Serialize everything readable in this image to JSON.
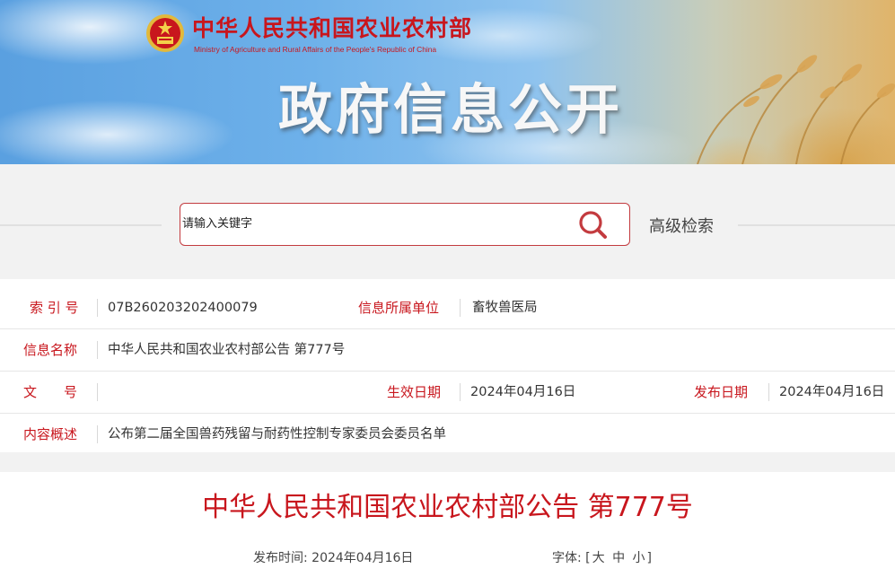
{
  "header": {
    "ministry_name": "中华人民共和国农业农村部",
    "ministry_name_en": "Ministry of Agriculture and Rural Affairs of the People's Republic of China",
    "section_title": "政府信息公开",
    "emblem_icon": "national-emblem-icon"
  },
  "search": {
    "placeholder": "请输入关键字",
    "value": "",
    "search_icon": "search-icon",
    "advanced_label": "高级检索"
  },
  "metadata": {
    "index_label": "索 引 号",
    "index_value": "07B260203202400079",
    "org_label": "信息所属单位",
    "org_value": "畜牧兽医局",
    "name_label": "信息名称",
    "name_value": "中华人民共和国农业农村部公告 第777号",
    "doc_no_label": "文　　号",
    "doc_no_value": "",
    "effective_label": "生效日期",
    "effective_value": "2024年04月16日",
    "publish_label": "发布日期",
    "publish_value": "2024年04月16日",
    "summary_label": "内容概述",
    "summary_value": "公布第二届全国兽药残留与耐药性控制专家委员会委员名单"
  },
  "article": {
    "title": "中华人民共和国农业农村部公告 第777号",
    "publish_time_label": "发布时间:",
    "publish_time_value": "2024年04月16日",
    "font_label": "字体:",
    "font_bracket_open": "[",
    "font_large": "大",
    "font_medium": "中",
    "font_small": "小",
    "font_bracket_close": "]"
  },
  "colors": {
    "accent_red": "#c8161d",
    "search_border": "#c33b3f",
    "band_gray": "#f2f2f2"
  }
}
